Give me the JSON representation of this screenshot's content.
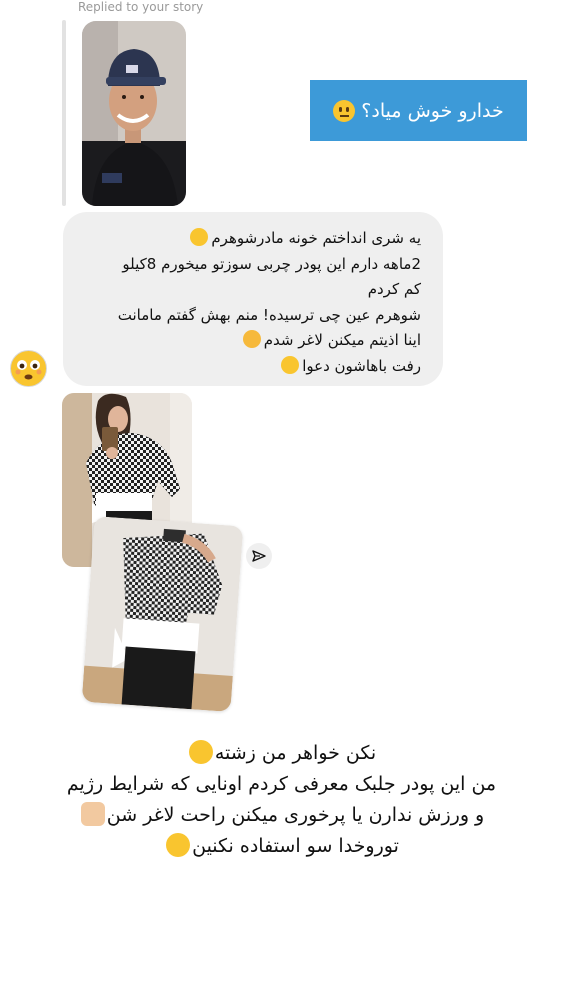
{
  "reply_label": "Replied to your story",
  "sent_message": {
    "text": "خدارو خوش میاد؟",
    "emoji": "neutral-face-emoji",
    "bubble_color": "#3d9ad8"
  },
  "received_message": {
    "lines": [
      "یه شری انداختم خونه مادرشوهرم",
      "2ماهه دارم این پودر چربی سوزتو میخورم 8کیلو",
      "کم کردم",
      "شوهرم عین چی ترسیده! منم بهش گفتم مامانت",
      "اینا اذیتم میکنن لاغر شدم",
      "رفت باهاشون دعوا"
    ],
    "emojis": [
      "laughing-emoji",
      "shushing-emoji",
      "zany-face-emoji"
    ],
    "bubble_color": "#efefef"
  },
  "avatar": {
    "icon": "flushed-face-emoji"
  },
  "photos": {
    "first": "mirror-selfie-photo",
    "second": "mirror-selfie-photo-closeup"
  },
  "caption": {
    "lines": [
      "نکن خواهر من زشته",
      "من این پودر جلبک معرفی کردم اونایی که شرایط رژیم",
      "و ورزش ندارن یا پرخوری میکنن راحت لاغر شن",
      "توروخدا سو استفاده نکنین"
    ],
    "emojis": [
      "neutral-face-emoji",
      "facepalm-emoji",
      "grinning-sweat-emoji"
    ]
  }
}
